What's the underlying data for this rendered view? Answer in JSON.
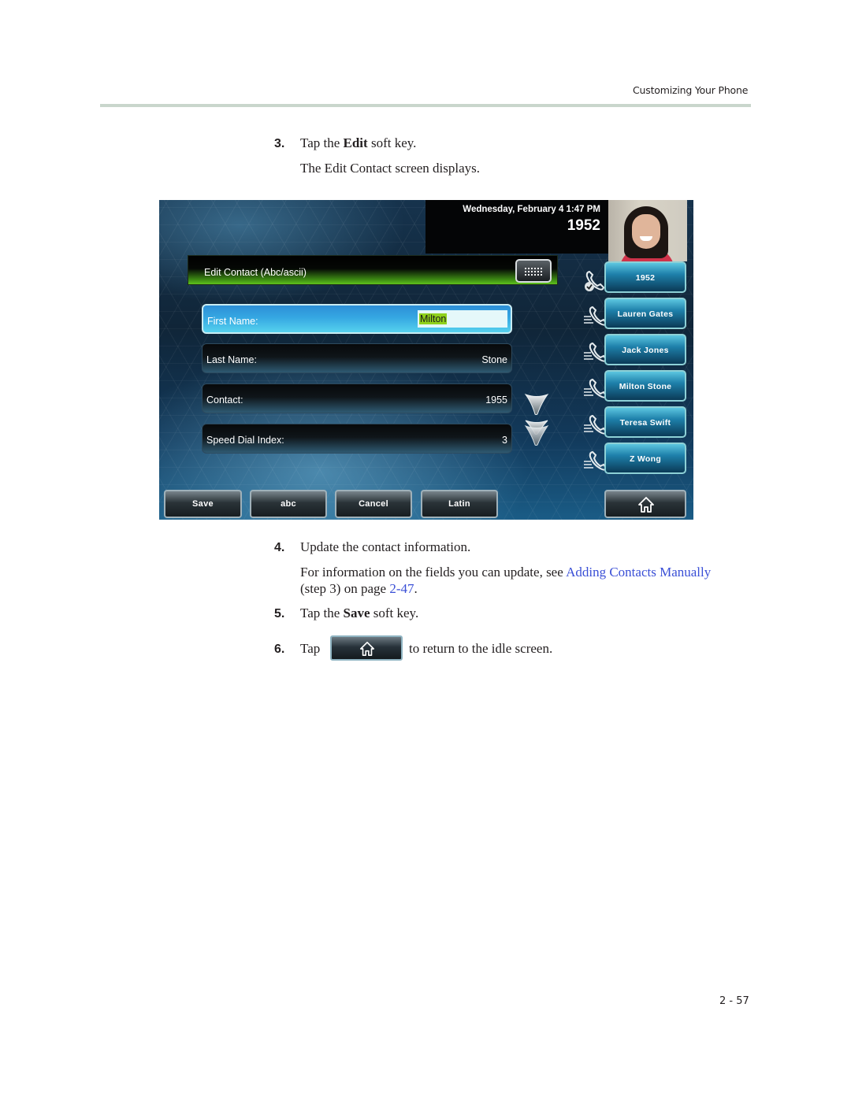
{
  "header": {
    "running_title": "Customizing Your Phone"
  },
  "steps": [
    {
      "number": "3.",
      "text_before": "Tap the ",
      "keyword": "Edit",
      "text_after": " soft key."
    },
    {
      "number": "4.",
      "text": "Update the contact information."
    },
    {
      "number": "5.",
      "text_before": "Tap the ",
      "keyword": "Save",
      "text_after": " soft key."
    },
    {
      "number": "6.",
      "text_before": "Tap",
      "text_after": "to return to the idle screen."
    }
  ],
  "paragraphs": {
    "edit_screen": "The Edit Contact screen displays.",
    "more_info_before": "For information on the fields you can update, see ",
    "more_info_link": "Adding Contacts Manually",
    "more_info_mid": " (step 3) on page ",
    "more_info_page_link": "2-47",
    "more_info_end": "."
  },
  "phone_screen": {
    "status": {
      "datetime": "Wednesday, February 4  1:47 PM",
      "extension": "1952"
    },
    "title": "Edit Contact (Abc/ascii)",
    "keyboard_icon": "keyboard-icon",
    "fields": [
      {
        "label": "First Name:",
        "value": "Milton",
        "active": true
      },
      {
        "label": "Last Name:",
        "value": "Stone"
      },
      {
        "label": "Contact:",
        "value": "1955"
      },
      {
        "label": "Speed Dial Index:",
        "value": "3"
      }
    ],
    "line_keys": [
      {
        "label": "1952",
        "icon": "registered-line-icon"
      },
      {
        "label": "Lauren Gates",
        "icon": "speed-dial-icon"
      },
      {
        "label": "Jack Jones",
        "icon": "speed-dial-icon"
      },
      {
        "label": "Milton Stone",
        "icon": "speed-dial-icon"
      },
      {
        "label": "Teresa Swift",
        "icon": "speed-dial-icon"
      },
      {
        "label": "Z Wong",
        "icon": "speed-dial-icon"
      }
    ],
    "soft_keys": [
      {
        "label": "Save"
      },
      {
        "label": "abc"
      },
      {
        "label": "Cancel"
      },
      {
        "label": "Latin"
      }
    ],
    "home_icon": "home-icon"
  },
  "footer": {
    "page_number": "2 - 57"
  }
}
